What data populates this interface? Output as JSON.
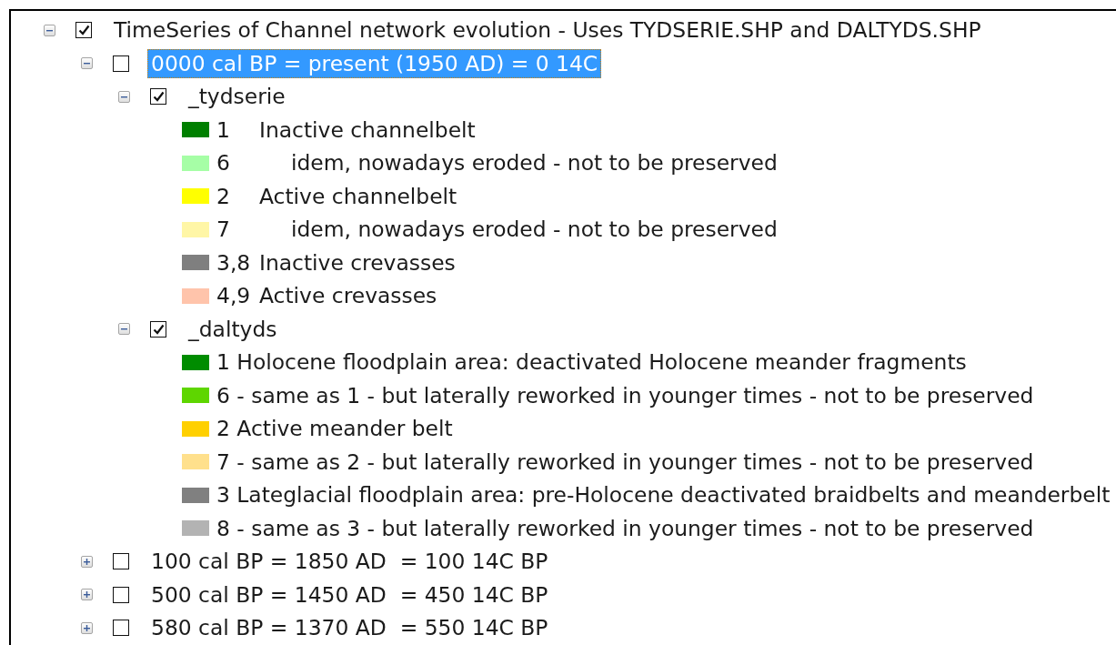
{
  "tree": [
    {
      "label": "TimeSeries of Channel network evolution - Uses TYDSERIE.SHP and DALTYDS.SHP",
      "checked": true,
      "expanded": true,
      "selected": false,
      "children": [
        {
          "label": "0000 cal BP = present (1950 AD) = 0 14C",
          "checked": false,
          "expanded": true,
          "selected": true,
          "children": [
            {
              "label": "_tydserie",
              "checked": true,
              "expanded": true,
              "selected": false,
              "legend": [
                {
                  "color": "#007f00",
                  "code": "1",
                  "label": "Inactive channelbelt",
                  "indented": false
                },
                {
                  "color": "#a6fea6",
                  "code": "6",
                  "label": "idem, nowadays eroded - not to be preserved",
                  "indented": true
                },
                {
                  "color": "#ffff00",
                  "code": "2",
                  "label": "Active channelbelt",
                  "indented": false
                },
                {
                  "color": "#fff6a6",
                  "code": "7",
                  "label": "idem, nowadays eroded - not to be preserved",
                  "indented": true
                },
                {
                  "color": "#7f7f7f",
                  "code": "3,8",
                  "label": "Inactive crevasses",
                  "indented": false
                },
                {
                  "color": "#ffc4ab",
                  "code": "4,9",
                  "label": "Active crevasses",
                  "indented": false
                }
              ]
            },
            {
              "label": "_daltyds",
              "checked": true,
              "expanded": true,
              "selected": false,
              "legend": [
                {
                  "color": "#008c00",
                  "label": "1 Holocene floodplain area: deactivated Holocene meander fragments"
                },
                {
                  "color": "#5ed600",
                  "label": "6 - same as 1 - but laterally reworked in younger times - not to be preserved"
                },
                {
                  "color": "#ffd000",
                  "label": "2 Active meander belt"
                },
                {
                  "color": "#ffe08c",
                  "label": "7 - same as 2 - but laterally reworked in younger times - not to be preserved"
                },
                {
                  "color": "#808080",
                  "label": "3 Lateglacial floodplain area: pre-Holocene deactivated braidbelts and meanderbelt"
                },
                {
                  "color": "#b3b3b3",
                  "label": "8 - same as 3 - but laterally reworked in younger times - not to be preserved"
                }
              ]
            }
          ]
        },
        {
          "label": "100 cal BP = 1850 AD  = 100 14C BP",
          "checked": false,
          "expanded": false,
          "selected": false
        },
        {
          "label": "500 cal BP = 1450 AD  = 450 14C BP",
          "checked": false,
          "expanded": false,
          "selected": false
        },
        {
          "label": "580 cal BP = 1370 AD  = 550 14C BP",
          "checked": false,
          "expanded": false,
          "selected": false
        }
      ]
    }
  ]
}
